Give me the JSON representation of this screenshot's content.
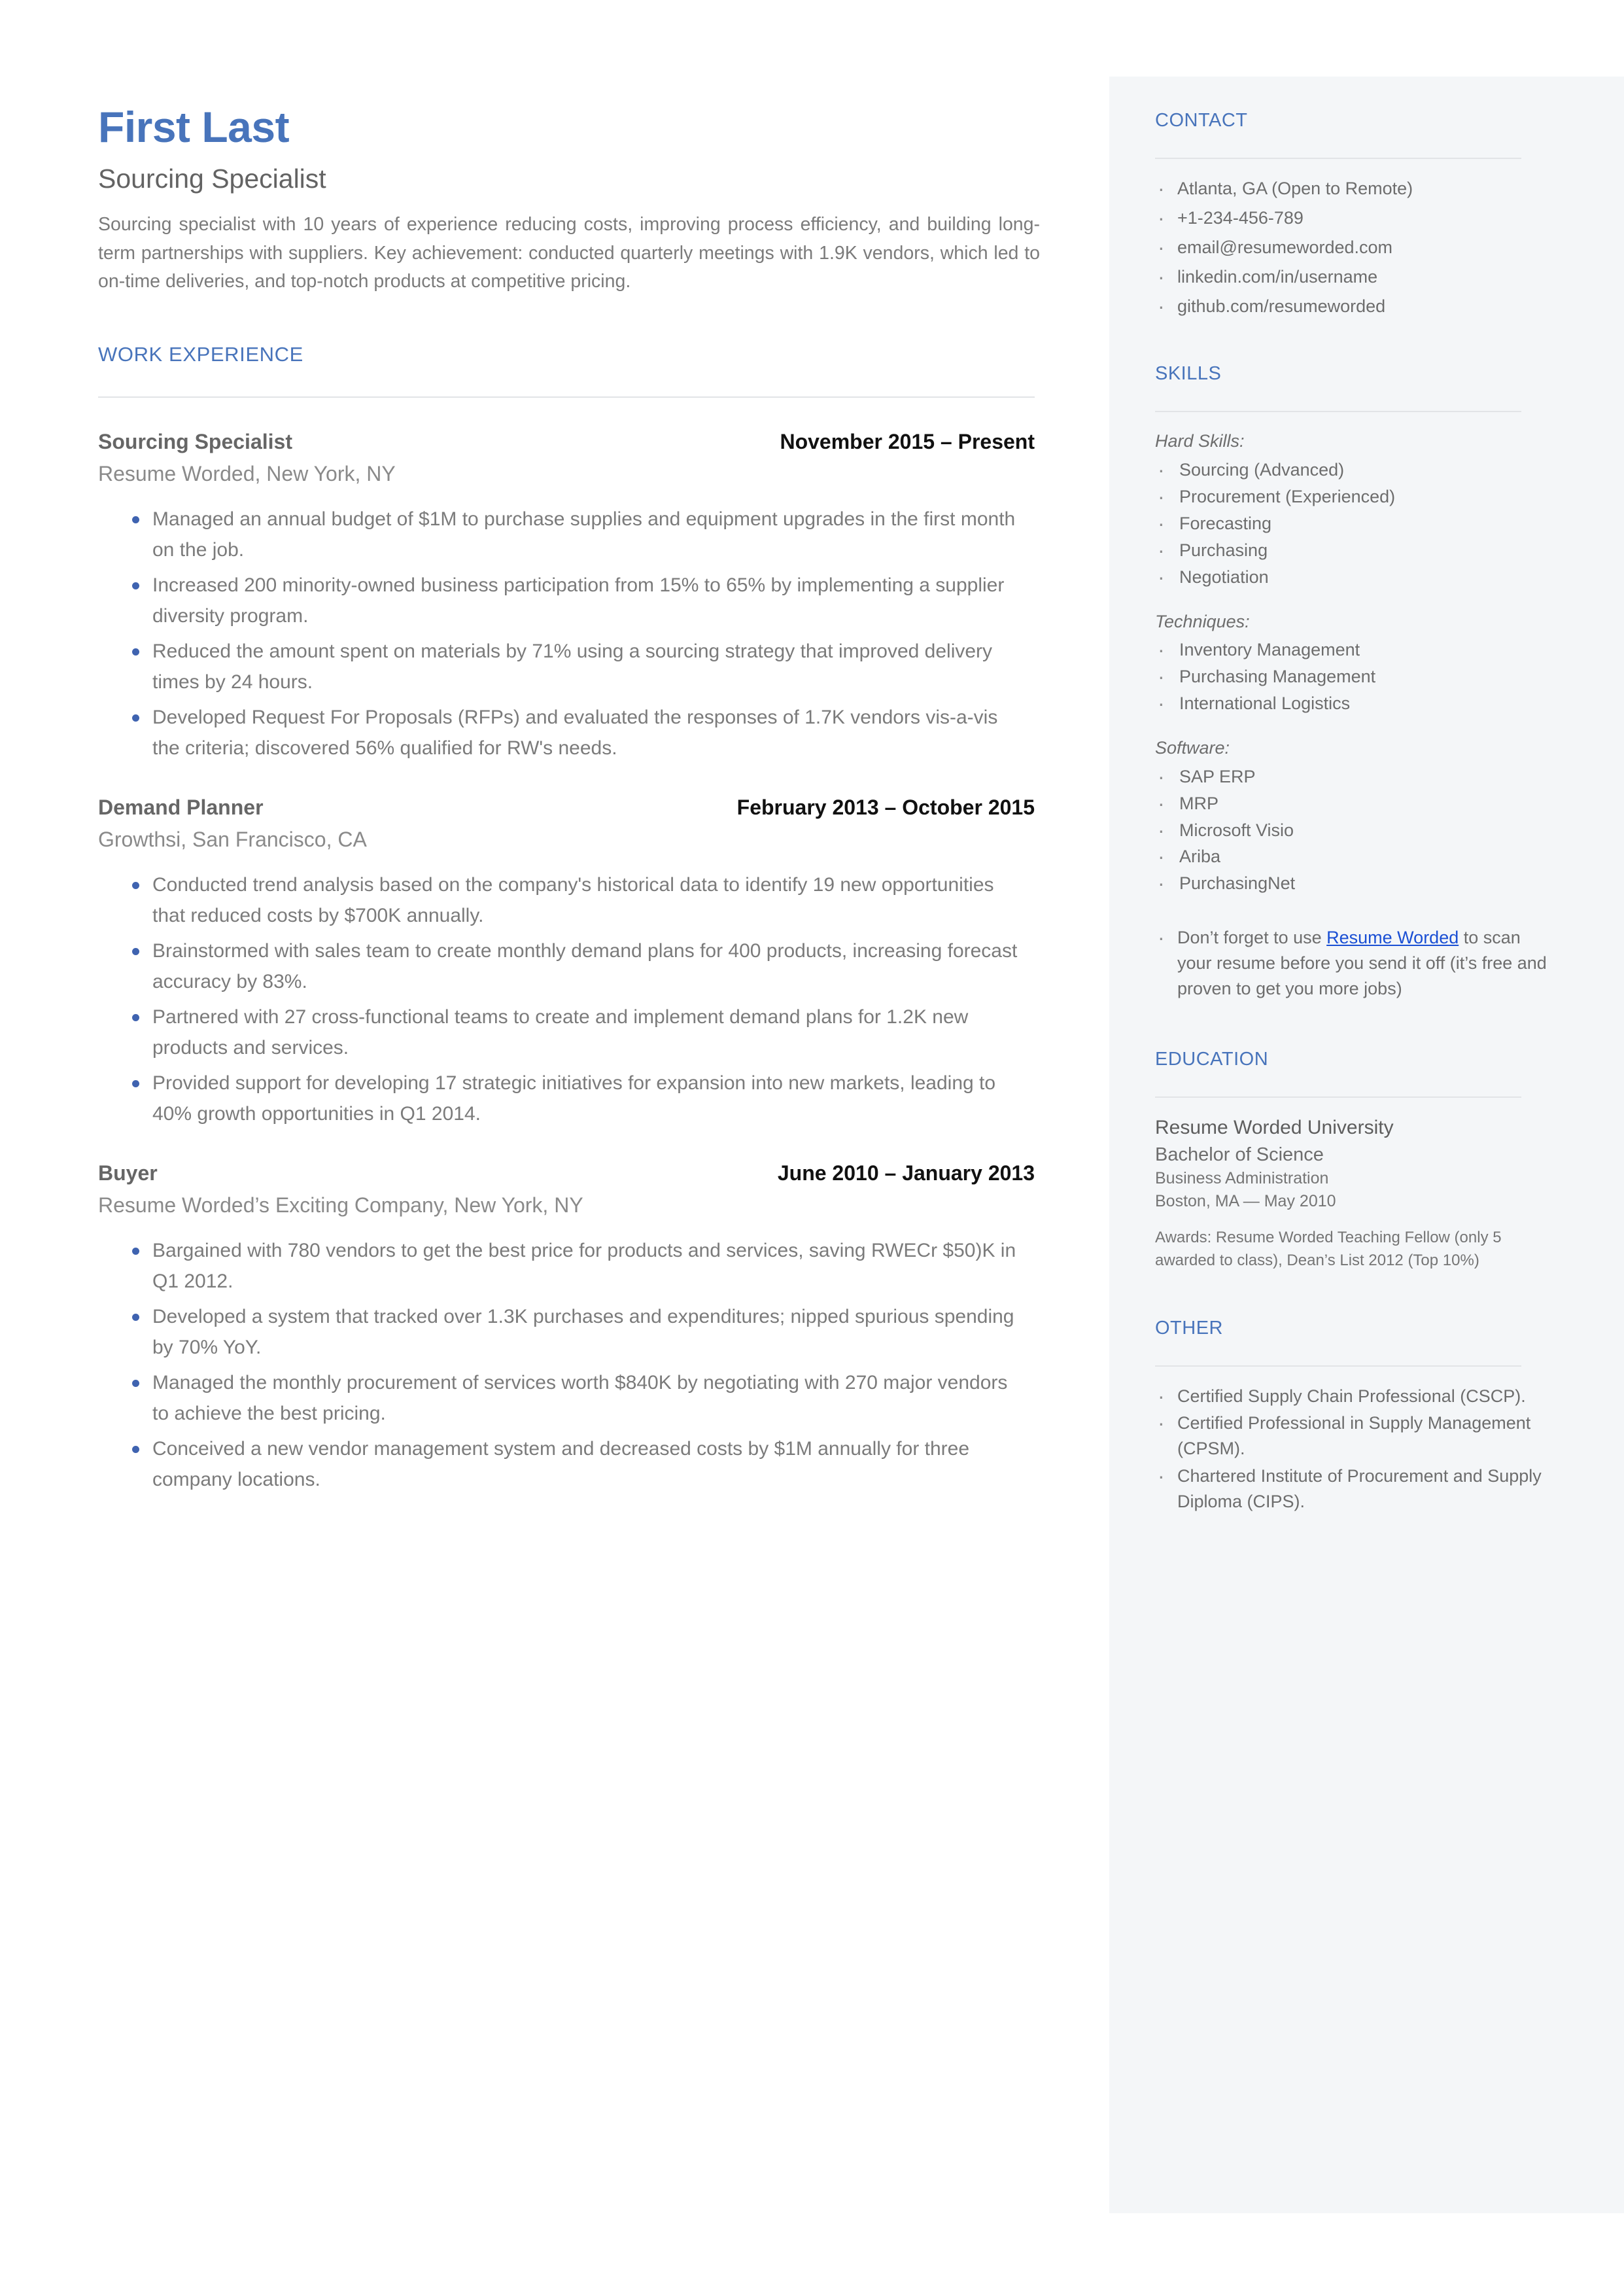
{
  "header": {
    "name": "First Last",
    "title": "Sourcing Specialist",
    "summary": "Sourcing specialist with 10 years of experience reducing costs, improving process efficiency, and building long-term partnerships with suppliers. Key achievement: conducted quarterly meetings with 1.9K vendors, which led to on-time deliveries, and top-notch products at competitive pricing."
  },
  "colors": {
    "accent_blue": "#4874bb",
    "bullet_blue": "#3f63b0",
    "link_blue": "#1a4fd4",
    "sidebar_bg": "#f4f6f8",
    "body_gray": "#7b7b7b",
    "divider": "#e2e4e7"
  },
  "work": {
    "heading": "WORK EXPERIENCE",
    "jobs": [
      {
        "title": "Sourcing Specialist",
        "dates": "November 2015 – Present",
        "company": "Resume Worded, New York, NY",
        "bullets": [
          "Managed an annual budget of $1M to purchase supplies and equipment upgrades in the first month on the job.",
          "Increased 200 minority-owned business participation from 15% to 65% by implementing a supplier diversity program.",
          "Reduced the amount spent on materials by 71% using a sourcing strategy that improved delivery times by 24 hours.",
          "Developed Request For Proposals (RFPs) and evaluated the responses of 1.7K vendors vis-a-vis the criteria; discovered 56% qualified for RW's needs."
        ]
      },
      {
        "title": "Demand Planner",
        "dates": "February 2013 – October 2015",
        "company": "Growthsi, San Francisco, CA",
        "bullets": [
          "Conducted trend analysis based on the company's historical data to identify 19 new opportunities that reduced costs by $700K annually.",
          "Brainstormed with sales team to create monthly demand plans for 400 products, increasing forecast accuracy by 83%.",
          "Partnered with 27 cross-functional teams to create and implement demand plans for 1.2K new products and services.",
          "Provided support for developing 17 strategic initiatives for expansion into new markets, leading to 40% growth opportunities in Q1 2014."
        ]
      },
      {
        "title": "Buyer",
        "dates": "June 2010 – January 2013",
        "company": "Resume Worded’s Exciting Company, New York, NY",
        "bullets": [
          "Bargained with 780 vendors to get the best price for products and services, saving RWECr $50)K in Q1 2012.",
          "Developed a system that tracked over 1.3K purchases and expenditures; nipped spurious spending by 70% YoY.",
          "Managed the monthly procurement of services worth $840K by negotiating with 270 major vendors to achieve the best pricing.",
          "Conceived a new vendor management system and decreased costs by $1M annually for three company locations."
        ]
      }
    ]
  },
  "contact": {
    "heading": "CONTACT",
    "items": [
      "Atlanta, GA (Open to Remote)",
      "+1-234-456-789",
      "email@resumeworded.com",
      "linkedin.com/in/username",
      "github.com/resumeworded"
    ]
  },
  "skills": {
    "heading": "SKILLS",
    "groups": [
      {
        "label": "Hard Skills:",
        "items": [
          "Sourcing (Advanced)",
          "Procurement (Experienced)",
          "Forecasting",
          "Purchasing",
          "Negotiation"
        ]
      },
      {
        "label": "Techniques:",
        "items": [
          "Inventory Management",
          "Purchasing Management",
          "International Logistics"
        ]
      },
      {
        "label": "Software:",
        "items": [
          "SAP ERP",
          "MRP",
          "Microsoft Visio",
          "Ariba",
          "PurchasingNet"
        ]
      }
    ],
    "note": {
      "before": "Don’t forget to use ",
      "link": "Resume Worded",
      "after": " to scan your resume before you send it off (it’s free and proven to get you more jobs)"
    }
  },
  "education": {
    "heading": "EDUCATION",
    "school": "Resume Worded University",
    "degree": "Bachelor of Science",
    "field": "Business Administration",
    "location_date": "Boston, MA — May 2010",
    "awards": "Awards: Resume Worded Teaching Fellow (only 5 awarded to class), Dean’s List 2012 (Top 10%)"
  },
  "other": {
    "heading": "OTHER",
    "items": [
      "Certified Supply Chain Professional (CSCP).",
      "Certified Professional in Supply Management (CPSM).",
      "Chartered Institute of Procurement and Supply Diploma (CIPS)."
    ]
  }
}
